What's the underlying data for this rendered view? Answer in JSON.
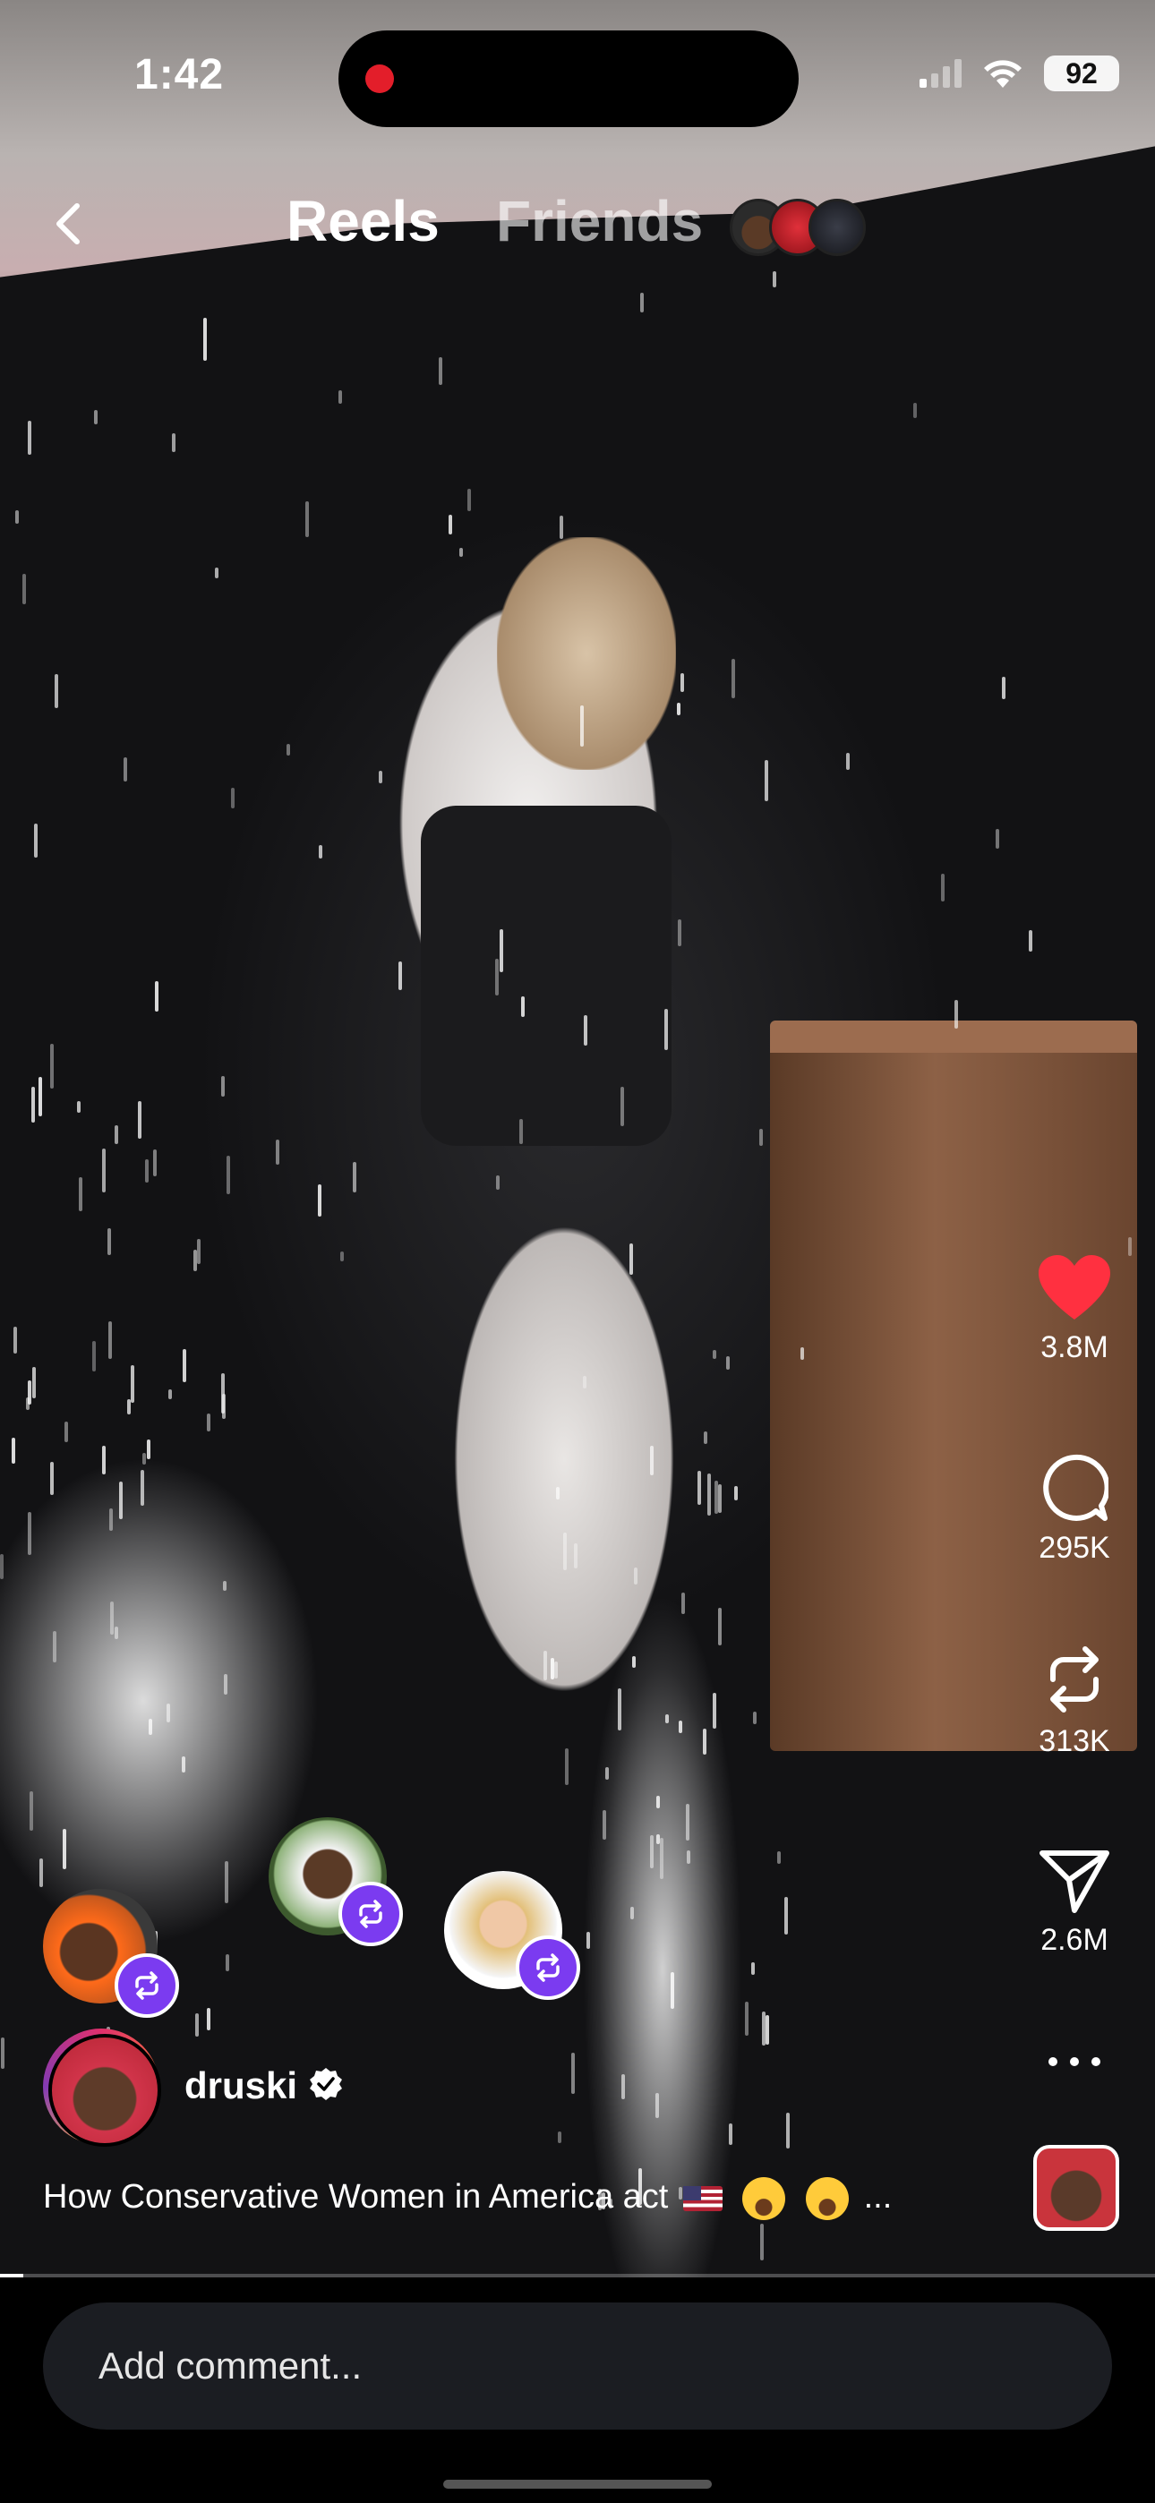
{
  "status_bar": {
    "time": "1:42",
    "battery": "92",
    "recording_indicator_color": "#e31e2a",
    "icons": [
      "cellular-signal-icon",
      "wifi-icon",
      "battery-icon"
    ]
  },
  "nav": {
    "back_icon": "chevron-left-icon",
    "tabs": [
      {
        "label": "Reels",
        "active": true
      },
      {
        "label": "Friends",
        "active": false
      }
    ]
  },
  "actions": {
    "likes": "3.8M",
    "comments": "295K",
    "reposts": "313K",
    "shares": "2.6M",
    "like_color": "#ff3040"
  },
  "creator": {
    "username": "druski",
    "verified": true
  },
  "caption": {
    "text": "How Conservative Women in America act",
    "ellipsis": "..."
  },
  "reposters": {
    "badge_color": "#7b3bf0",
    "count": 3
  },
  "comment": {
    "placeholder": "Add comment..."
  },
  "video_progress": 0.02
}
